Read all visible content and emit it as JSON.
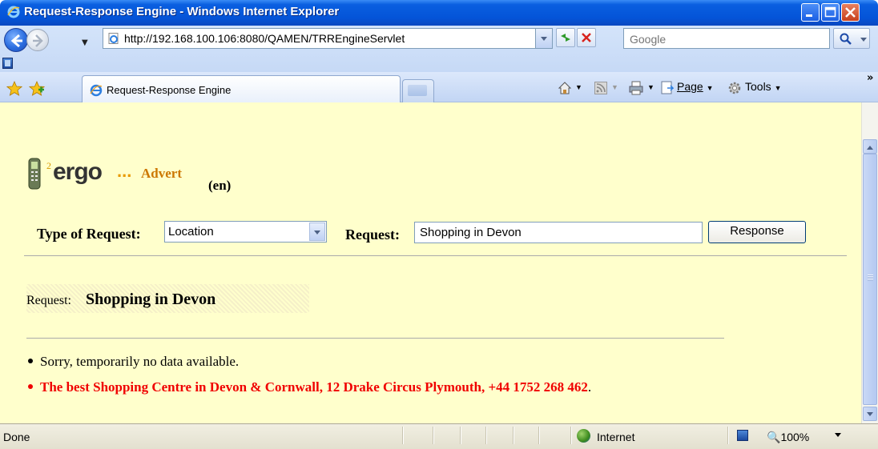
{
  "window": {
    "title": "Request-Response Engine - Windows Internet Explorer"
  },
  "addressbar": {
    "url": "http://192.168.100.106:8080/QAMEN/TRREngineServlet",
    "search_placeholder": "Google"
  },
  "tabs": [
    {
      "label": "Request-Response Engine"
    }
  ],
  "commandbar": {
    "page_label": "Page",
    "tools_label": "Tools"
  },
  "page": {
    "logo_text": "ergo",
    "logo_superscript": "2",
    "logo_dots": "...",
    "logo_advert": "Advert",
    "language": "(en)",
    "type_label": "Type of Request:",
    "type_value": "Location",
    "request_label": "Request:",
    "request_value": "Shopping in Devon",
    "response_button": "Response",
    "echo_label": "Request:",
    "echo_value": "Shopping in Devon",
    "results": [
      "Sorry, temporarily no data available.",
      "The best Shopping Centre in Devon & Cornwall, 12 Drake Circus Plymouth, +44 1752 268 462"
    ],
    "result_suffix": "."
  },
  "statusbar": {
    "status": "Done",
    "zone": "Internet",
    "zoom": "100%"
  },
  "colors": {
    "page_background": "#ffffcc",
    "highlight_result": "#f00000",
    "titlebar": "#0454d8"
  },
  "icons": [
    "ie-logo-icon",
    "back-arrow-icon",
    "forward-arrow-icon",
    "page-icon",
    "refresh-icon",
    "stop-icon",
    "search-icon",
    "favorites-star-icon",
    "add-favorites-icon",
    "home-icon",
    "feeds-icon",
    "print-icon",
    "page-menu-icon",
    "tools-gear-icon",
    "globe-icon",
    "phone-logo-icon"
  ]
}
